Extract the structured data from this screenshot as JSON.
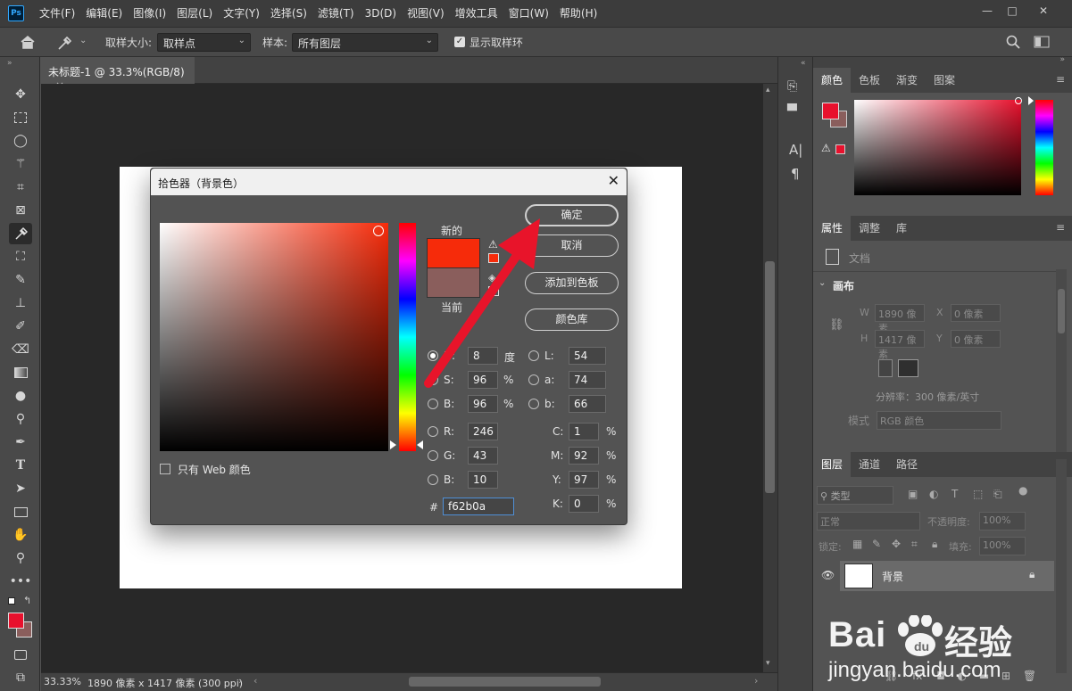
{
  "menubar": {
    "logo": "Ps",
    "items": [
      "文件(F)",
      "编辑(E)",
      "图像(I)",
      "图层(L)",
      "文字(Y)",
      "选择(S)",
      "滤镜(T)",
      "3D(D)",
      "视图(V)",
      "增效工具",
      "窗口(W)",
      "帮助(H)"
    ],
    "minimize": "—",
    "maximize": "□",
    "close": "✕"
  },
  "options": {
    "sample_size_label": "取样大小:",
    "sample_size_value": "取样点",
    "sample_label": "样本:",
    "sample_value": "所有图层",
    "show_ring_label": "显示取样环"
  },
  "document": {
    "tab_title": "未标题-1 @ 33.3%(RGB/8)",
    "tab_close": "×",
    "zoom": "33.33%",
    "info": "1890 像素 x 1417 像素 (300 ppi)"
  },
  "dialog": {
    "title": "拾色器（背景色）",
    "close": "✕",
    "new_label": "新的",
    "current_label": "当前",
    "new_color": "#f62b0a",
    "current_color": "#8a5e5c",
    "only_web_label": "只有 Web 颜色",
    "buttons": {
      "ok": "确定",
      "cancel": "取消",
      "add_swatch": "添加到色板",
      "color_lib": "颜色库"
    },
    "hsb": {
      "h_label": "H:",
      "h": "8",
      "h_unit": "度",
      "s_label": "S:",
      "s": "96",
      "s_unit": "%",
      "b_label": "B:",
      "b": "96",
      "b_unit": "%"
    },
    "rgb": {
      "r_label": "R:",
      "r": "246",
      "g_label": "G:",
      "g": "43",
      "b_label": "B:",
      "b": "10"
    },
    "lab": {
      "l_label": "L:",
      "l": "54",
      "a_label": "a:",
      "a": "74",
      "b_label": "b:",
      "b": "66"
    },
    "cmyk": {
      "c_label": "C:",
      "c": "1",
      "m_label": "M:",
      "m": "92",
      "y_label": "Y:",
      "y": "97",
      "k_label": "K:",
      "k": "0",
      "unit": "%"
    },
    "hex_label": "#",
    "hex": "f62b0a"
  },
  "color_panel": {
    "tabs": [
      "颜色",
      "色板",
      "渐变",
      "图案"
    ],
    "fg_color": "#e8112d",
    "bg_color": "#8a5e5c"
  },
  "properties_panel": {
    "tabs": [
      "属性",
      "调整",
      "库"
    ],
    "doc_label": "文档",
    "section": "画布",
    "w_label": "W",
    "w_value": "1890 像素",
    "h_label": "H",
    "h_value": "1417 像素",
    "x_label": "X",
    "x_value": "0 像素",
    "y_label": "Y",
    "y_value": "0 像素",
    "resolution": "分辨率：300 像素/英寸",
    "mode_label": "模式",
    "mode_value": "RGB 颜色"
  },
  "layers_panel": {
    "tabs": [
      "图层",
      "通道",
      "路径"
    ],
    "filter_value": "类型",
    "blend_mode": "正常",
    "opacity_label": "不透明度:",
    "opacity_value": "100%",
    "lock_label": "锁定:",
    "fill_label": "填充:",
    "fill_value": "100%",
    "layer_name": "背景"
  },
  "watermark": {
    "brand": "Bai",
    "brand2": "经验",
    "url": "jingyan.baidu.com"
  }
}
